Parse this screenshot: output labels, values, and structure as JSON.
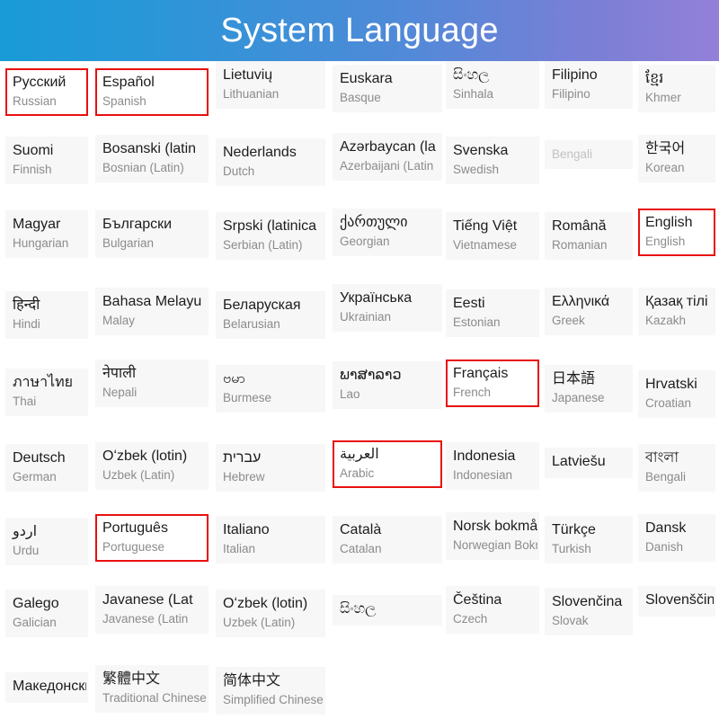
{
  "header": {
    "title": "System Language",
    "gradient_from": "#189bd7",
    "gradient_to": "#9380d8",
    "title_color": "#ffffff"
  },
  "theme": {
    "highlight_color": "#e8100f",
    "cell_background": "#f7f7f7",
    "native_text_color": "#1c1c1c",
    "english_text_color": "#8b8b8b",
    "page_background": "#ffffff"
  },
  "rows": [
    [
      {
        "native": "Русский",
        "english": "Russian",
        "highlighted": true
      },
      {
        "native": "Español",
        "english": "Spanish",
        "highlighted": true
      },
      {
        "native": "Lietuvių",
        "english": "Lithuanian",
        "highlighted": false
      },
      {
        "native": "Euskara",
        "english": "Basque",
        "highlighted": false
      },
      {
        "native": "සිංහල",
        "english": "Sinhala",
        "highlighted": false
      },
      {
        "native": "Filipino",
        "english": "Filipino",
        "highlighted": false
      },
      {
        "native": "ខ្មែរ",
        "english": "Khmer",
        "highlighted": false
      }
    ],
    [
      {
        "native": "Suomi",
        "english": "Finnish",
        "highlighted": false
      },
      {
        "native": "Bosanski (latin",
        "english": "Bosnian (Latin)",
        "highlighted": false
      },
      {
        "native": "Nederlands",
        "english": "Dutch",
        "highlighted": false
      },
      {
        "native": "Azərbaycan (la",
        "english": "Azerbaijani (Latin",
        "highlighted": false
      },
      {
        "native": "Svenska",
        "english": "Swedish",
        "highlighted": false
      },
      {
        "native": "",
        "english": "Bengali",
        "highlighted": false,
        "faded": true
      },
      {
        "native": "한국어",
        "english": "Korean",
        "highlighted": false
      }
    ],
    [
      {
        "native": "Magyar",
        "english": "Hungarian",
        "highlighted": false
      },
      {
        "native": "Български",
        "english": "Bulgarian",
        "highlighted": false
      },
      {
        "native": "Srpski (latinica",
        "english": "Serbian (Latin)",
        "highlighted": false
      },
      {
        "native": "ქართული",
        "english": "Georgian",
        "highlighted": false
      },
      {
        "native": "Tiếng Việt",
        "english": "Vietnamese",
        "highlighted": false
      },
      {
        "native": "Română",
        "english": "Romanian",
        "highlighted": false
      },
      {
        "native": "English",
        "english": "English",
        "highlighted": true
      }
    ],
    [
      {
        "native": "हिन्दी",
        "english": "Hindi",
        "highlighted": false
      },
      {
        "native": "Bahasa Melayu",
        "english": "Malay",
        "highlighted": false
      },
      {
        "native": "Беларуская",
        "english": "Belarusian",
        "highlighted": false
      },
      {
        "native": "Українська",
        "english": "Ukrainian",
        "highlighted": false
      },
      {
        "native": "Eesti",
        "english": "Estonian",
        "highlighted": false
      },
      {
        "native": "Ελληνικά",
        "english": "Greek",
        "highlighted": false
      },
      {
        "native": "Қазақ тілі",
        "english": "Kazakh",
        "highlighted": false
      }
    ],
    [
      {
        "native": "ภาษาไทย",
        "english": "Thai",
        "highlighted": false
      },
      {
        "native": "नेपाली",
        "english": "Nepali",
        "highlighted": false
      },
      {
        "native": "ဗမာ",
        "english": "Burmese",
        "highlighted": false
      },
      {
        "native": "ພາສາລາວ",
        "english": "Lao",
        "highlighted": false
      },
      {
        "native": "Français",
        "english": "French",
        "highlighted": true
      },
      {
        "native": "日本語",
        "english": "Japanese",
        "highlighted": false
      },
      {
        "native": "Hrvatski",
        "english": "Croatian",
        "highlighted": false
      }
    ],
    [
      {
        "native": "Deutsch",
        "english": "German",
        "highlighted": false
      },
      {
        "native": "Oʻzbek (lotin)",
        "english": "Uzbek (Latin)",
        "highlighted": false
      },
      {
        "native": "עברית",
        "english": "Hebrew",
        "highlighted": false
      },
      {
        "native": "العربية",
        "english": "Arabic",
        "highlighted": true
      },
      {
        "native": "Indonesia",
        "english": "Indonesian",
        "highlighted": false
      },
      {
        "native": "Latviešu",
        "english": "",
        "highlighted": false
      },
      {
        "native": "বাংলা",
        "english": "Bengali",
        "highlighted": false
      }
    ],
    [
      {
        "native": "اردو",
        "english": "Urdu",
        "highlighted": false
      },
      {
        "native": "Português",
        "english": "Portuguese",
        "highlighted": true
      },
      {
        "native": "Italiano",
        "english": "Italian",
        "highlighted": false
      },
      {
        "native": "Català",
        "english": "Catalan",
        "highlighted": false
      },
      {
        "native": "Norsk bokmål",
        "english": "Norwegian Bokm",
        "highlighted": false
      },
      {
        "native": "Türkçe",
        "english": "Turkish",
        "highlighted": false
      },
      {
        "native": "Dansk",
        "english": "Danish",
        "highlighted": false
      }
    ],
    [
      {
        "native": "Galego",
        "english": "Galician",
        "highlighted": false
      },
      {
        "native": "Javanese (Lat",
        "english": "Javanese (Latin",
        "highlighted": false
      },
      {
        "native": "Oʻzbek (lotin)",
        "english": "Uzbek (Latin)",
        "highlighted": false
      },
      {
        "native": "සිංහල",
        "english": "",
        "highlighted": false
      },
      {
        "native": "Čeština",
        "english": "Czech",
        "highlighted": false
      },
      {
        "native": "Slovenčina",
        "english": "Slovak",
        "highlighted": false
      },
      {
        "native": "Slovenščina",
        "english": "",
        "highlighted": false
      }
    ],
    [
      {
        "native": "Македонски",
        "english": "",
        "highlighted": false
      },
      {
        "native": "繁體中文",
        "english": "Traditional Chinese",
        "highlighted": false
      },
      {
        "native": "简体中文",
        "english": "Simplified Chinese",
        "highlighted": false
      }
    ]
  ]
}
